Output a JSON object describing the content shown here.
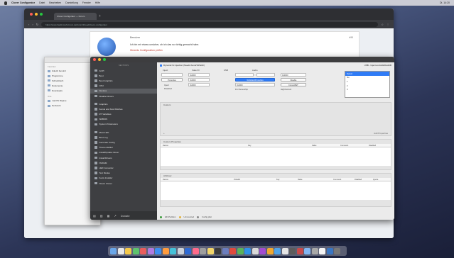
{
  "menubar": {
    "app_name": "Clover Configurator",
    "items": [
      "Datei",
      "Bearbeiten",
      "Darstellung",
      "Fenster",
      "Hilfe"
    ],
    "clock": "Di. 14:20"
  },
  "browser": {
    "tab_title": "Clover Configurator — Forum",
    "url": "https://www.hackintosh-forum.de/forum/thread/clover-configurator",
    "forum": {
      "user": "Benutzer",
      "post_text": "Ich bin mir etwas unsicher, ob ich das so richtig gemacht habe.",
      "post_red": "Hinweis: Konfiguration prüfen",
      "post_number": "#95"
    }
  },
  "finder": {
    "sections": [
      {
        "title": "Favoriten",
        "items": [
          "Zuletzt benutzt",
          "Programme",
          "Schreibtisch",
          "Dokumente",
          "Downloads"
        ]
      },
      {
        "title": "Orte",
        "items": [
          "macOS Mojave",
          "Netzwerk"
        ]
      }
    ]
  },
  "app": {
    "sidebar_header": "SECTIONS",
    "sidebar_groups": [
      [
        "ACPI",
        "Boot",
        "Boot Graphics",
        "CPU",
        "Devices",
        "Disable Drivers"
      ],
      [
        "Graphics",
        "Kernel and Kext Patches",
        "RT Variables",
        "SMBIOS",
        "System Parameters"
      ],
      [
        "Mount EFI",
        "Boot Log",
        "Generate Config",
        "Themes Editor",
        "Install/Update Clover",
        "Install Drivers",
        "NVRAM",
        "HEX Converter",
        "Text Modes",
        "Kexts Installer",
        "Clover Cloner"
      ]
    ],
    "selected_item": "Devices",
    "bottom_label": "Donate",
    "top_checkbox": "Dynamic fix injection (Needs KextsToPatch)",
    "top_right": "USB - Inject and AddClockID",
    "col_labels": [
      "Inject",
      "Fake ID",
      "USB",
      "Audio"
    ],
    "fields": {
      "fake_id_1": "0x0000",
      "intel_gfx": "0x0000",
      "audio_1": "0x0000",
      "wifi": "0x0000",
      "ati": "0x0000"
    },
    "buttons": {
      "properties": "Properties",
      "disable": "Disable",
      "no_default": "NoDefaultProperties",
      "force_hpet": "ForceHPET"
    },
    "check_labels": [
      "Inject",
      "Disabled",
      "Fix Ownership",
      "HighCurrent"
    ],
    "select_list": [
      "Detect",
      "No",
      "1",
      "2",
      "3"
    ],
    "select_selected": "Detect",
    "sections": {
      "custom": {
        "title": "Custom",
        "foot": "Add Properties"
      },
      "properties": {
        "title": "Custom Properties",
        "columns": [
          "Device",
          "Key",
          "Value",
          "Comment",
          "Disabled"
        ]
      },
      "arbitrary": {
        "title": "Arbitrary",
        "columns": [
          "Device",
          "PciAddr",
          "Key",
          "Value",
          "Comment",
          "Disabled",
          "Ignore"
        ]
      }
    },
    "status": [
      "EFI-Partition",
      "Unmounted",
      "Config.plist"
    ]
  },
  "dock_colors": [
    "#6aa6e8",
    "#e7e7e7",
    "#f4c84a",
    "#5ec36d",
    "#e85d5d",
    "#b07ae0",
    "#3d8ef0",
    "#ff9b3d",
    "#46c1d9",
    "#ccd2da",
    "#2e6ad4",
    "#ff6a8b",
    "#9e9e9e",
    "#f2d56a",
    "#3b3b3b",
    "#6b7dbd",
    "#e04a3d",
    "#59b35a",
    "#2f92e8",
    "#d9d9d9",
    "#a24cd1",
    "#f0a830",
    "#4fa3e8",
    "#e5e5e5",
    "#5c5c5c",
    "#c94a4a",
    "#82b6f2",
    "#a8a8a8",
    "#f5f5f5",
    "#3a76c2",
    "#777777"
  ]
}
